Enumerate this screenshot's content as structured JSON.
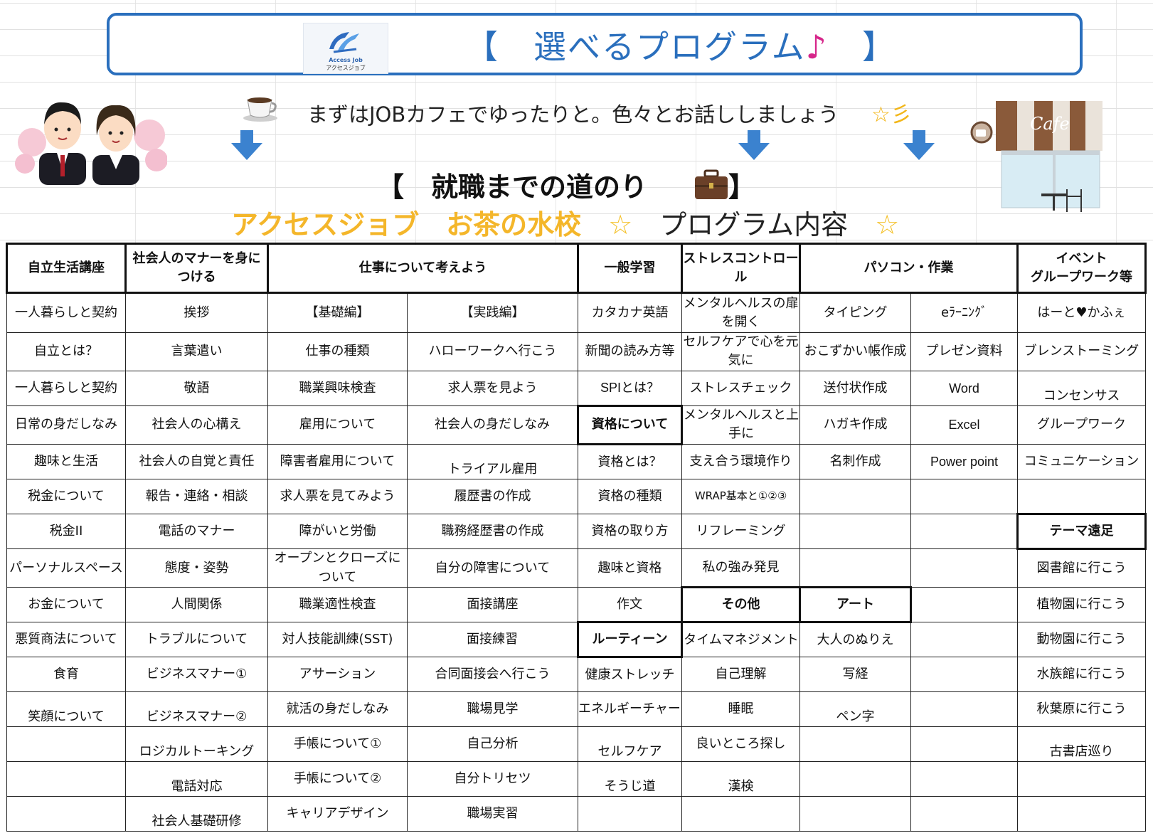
{
  "banner": {
    "logo_en": "Access Job",
    "logo_jp": "アクセスジョブ",
    "title_open": "【　選べるプログラム",
    "title_note": "♪",
    "title_close": "　】"
  },
  "intro": {
    "text": "まずはJOBカフェでゆったりと。色々とお話ししましょう",
    "star": "☆彡"
  },
  "cafe_sign": "Cafe",
  "section_title": "【　就職までの道のり　　　】",
  "subtitle": {
    "brand": "アクセスジョブ　お茶の水校",
    "star": "☆",
    "program": "プログラム内容"
  },
  "table": {
    "headers": [
      "自立生活講座",
      "社会人のマナーを身につける",
      "仕事について考えよう",
      "一般学習",
      "ストレスコントロール",
      "パソコン・作業",
      "イベント\nグループワーク等"
    ],
    "rows": [
      [
        "一人暮らしと契約",
        "挨拶",
        "【基礎編】",
        "【実践編】",
        "カタカナ英語",
        "メンタルヘルスの扉を開く",
        "タイピング",
        "eﾗｰﾆﾝｸﾞ",
        "はーと♥かふぇ"
      ],
      [
        "自立とは？",
        "言葉遣い",
        "仕事の種類",
        "ハローワークへ行こう",
        "新聞の読み方等",
        "セルフケアで心を元気に",
        "おこずかい帳作成",
        "プレゼン資料",
        "ブレンストーミング"
      ],
      [
        "一人暮らしと契約",
        "敬語",
        "職業興味検査",
        "求人票を見よう",
        "SPIとは？",
        "ストレスチェック",
        "送付状作成",
        "Word",
        "コンセンサス"
      ],
      [
        "日常の身だしなみ",
        "社会人の心構え",
        "雇用について",
        "社会人の身だしなみ",
        "資格について",
        "メンタルヘルスと上手に",
        "ハガキ作成",
        "Excel",
        "グループワーク"
      ],
      [
        "趣味と生活",
        "社会人の自覚と責任",
        "障害者雇用について",
        "トライアル雇用",
        "資格とは？",
        "支え合う環境作り",
        "名刺作成",
        "Power point",
        "コミュニケーション"
      ],
      [
        "税金について",
        "報告・連絡・相談",
        "求人票を見てみよう",
        "履歴書の作成",
        "資格の種類",
        "WRAP基本と①②③",
        "",
        "",
        ""
      ],
      [
        "税金II",
        "電話のマナー",
        "障がいと労働",
        "職務経歴書の作成",
        "資格の取り方",
        "リフレーミング",
        "",
        "",
        "テーマ遠足"
      ],
      [
        "パーソナルスペース",
        "態度・姿勢",
        "オープンとクローズについて",
        "自分の障害について",
        "趣味と資格",
        "私の強み発見",
        "",
        "",
        "図書館に行こう"
      ],
      [
        "お金について",
        "人間関係",
        "職業適性検査",
        "面接講座",
        "作文",
        "その他",
        "アート",
        "",
        "植物園に行こう"
      ],
      [
        "悪質商法について",
        "トラブルについて",
        "対人技能訓練(SST)",
        "面接練習",
        "ルーティーン",
        "タイムマネジメント",
        "大人のぬりえ",
        "",
        "動物園に行こう"
      ],
      [
        "食育",
        "ビジネスマナー①",
        "アサーション",
        "合同面接会へ行こう",
        "健康ストレッチ",
        "自己理解",
        "写経",
        "",
        "水族館に行こう"
      ],
      [
        "笑顔について",
        "ビジネスマナー②",
        "就活の身だしなみ",
        "職場見学",
        "エネルギーチャージ",
        "睡眠",
        "ペン字",
        "",
        "秋葉原に行こう"
      ],
      [
        "",
        "ロジカルトーキング",
        "手帳について①",
        "自己分析",
        "セルフケア",
        "良いところ探し",
        "",
        "",
        "古書店巡り"
      ],
      [
        "",
        "電話対応",
        "手帳について②",
        "自分トリセツ",
        "そうじ道",
        "漢検",
        "",
        "",
        ""
      ],
      [
        "",
        "社会人基礎研修",
        "キャリアデザイン",
        "職場実習",
        "",
        "",
        "",
        "",
        ""
      ]
    ]
  },
  "colors": {
    "banner_blue": "#2a6fbd",
    "note_pink": "#d6268a",
    "brand_orange": "#f4b62a",
    "arrow_blue": "#3b82cf"
  }
}
